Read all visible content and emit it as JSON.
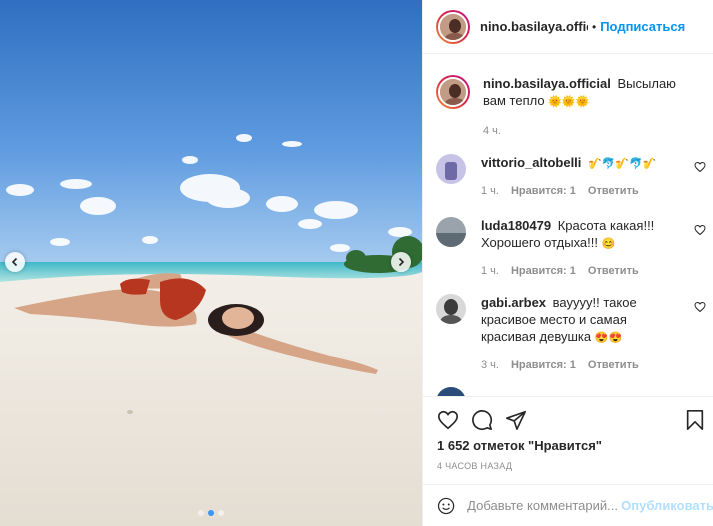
{
  "header": {
    "username": "nino.basilaya.official",
    "separator": "•",
    "follow_label": "Подписаться"
  },
  "caption": {
    "username": "nino.basilaya.official",
    "text": "Высылаю вам тепло",
    "emoji": "🌞🌞🌞",
    "time": "4 ч."
  },
  "comments": [
    {
      "username": "vittorio_altobelli",
      "text": "🎷🐬🎷🐬🎷",
      "time": "1 ч.",
      "likes": "Нравится: 1",
      "reply": "Ответить"
    },
    {
      "username": "luda180479",
      "text": "Красота какая!!! Хорошего отдыха!!!",
      "emoji": "😊",
      "time": "1 ч.",
      "likes": "Нравится: 1",
      "reply": "Ответить"
    },
    {
      "username": "gabi.arbex",
      "text": "вауууу!! такое красивое место и самая красивая девушка",
      "emoji": "😍😍",
      "time": "3 ч.",
      "likes": "Нравится: 1",
      "reply": "Ответить"
    }
  ],
  "actions": {
    "likes": "1 652 отметок \"Нравится\"",
    "posted": "4 ЧАСОВ НАЗАД"
  },
  "add_comment": {
    "placeholder": "Добавьте комментарий...",
    "publish_label": "Опубликовать"
  },
  "carousel": {
    "slides": 3,
    "active": 1
  },
  "colors": {
    "accent": "#0095f6",
    "publish_disabled": "#b2dffc",
    "muted": "#8e8e8e"
  }
}
